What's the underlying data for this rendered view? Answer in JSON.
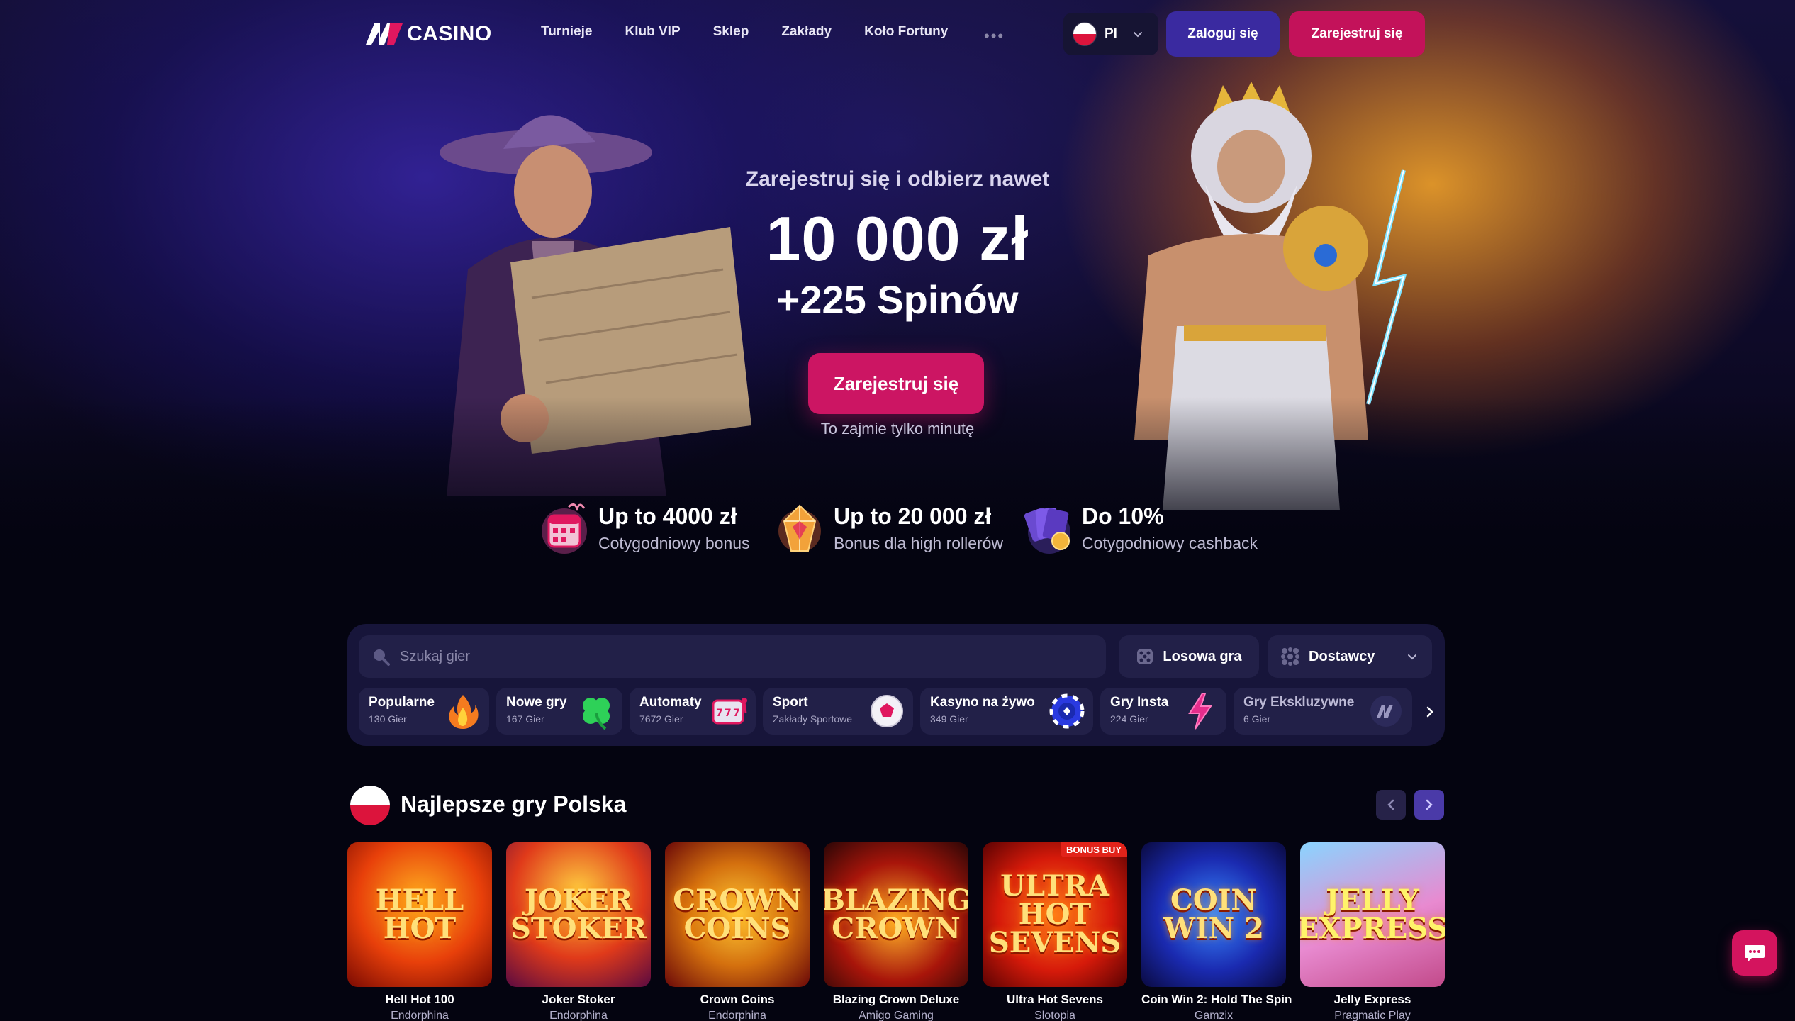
{
  "header": {
    "logo_text": "CASINO",
    "nav": [
      "Turnieje",
      "Klub VIP",
      "Sklep",
      "Zakłady",
      "Koło Fortuny"
    ],
    "more": "•••",
    "language": "Pl",
    "login_label": "Zaloguj się",
    "register_label": "Zarejestruj się"
  },
  "hero": {
    "subtitle": "Zarejestruj się i odbierz nawet",
    "amount": "10 000 zł",
    "spins": "+225 Spinów",
    "cta_label": "Zarejestruj się",
    "note": "To zajmie tylko minutę"
  },
  "benefits": [
    {
      "title": "Up to 4000 zł",
      "subtitle": "Cotygodniowy bonus",
      "icon": "calendar-gift-icon"
    },
    {
      "title": "Up to 20 000 zł",
      "subtitle": "Bonus dla high rollerów",
      "icon": "crystal-icon"
    },
    {
      "title": "Do 10%",
      "subtitle": "Cotygodniowy cashback",
      "icon": "cards-cashback-icon"
    }
  ],
  "games_panel": {
    "search_placeholder": "Szukaj gier",
    "random_label": "Losowa gra",
    "providers_label": "Dostawcy",
    "categories": [
      {
        "name": "Popularne",
        "count": "130 Gier",
        "icon": "fire-icon"
      },
      {
        "name": "Nowe gry",
        "count": "167 Gier",
        "icon": "clover-icon"
      },
      {
        "name": "Automaty",
        "count": "7672 Gier",
        "icon": "slot-machine-icon"
      },
      {
        "name": "Sport",
        "count": "Zakłady Sportowe",
        "icon": "football-icon"
      },
      {
        "name": "Kasyno na żywo",
        "count": "349 Gier",
        "icon": "poker-chip-icon"
      },
      {
        "name": "Gry Insta",
        "count": "224 Gier",
        "icon": "lightning-icon"
      },
      {
        "name": "Gry Ekskluzywne",
        "count": "6 Gier",
        "icon": "logo-badge-icon"
      }
    ]
  },
  "top_games": {
    "title": "Najlepsze gry Polska",
    "games": [
      {
        "name": "Hell Hot 100",
        "provider": "Endorphina",
        "thumb_text": "HELL HOT",
        "badge": ""
      },
      {
        "name": "Joker Stoker",
        "provider": "Endorphina",
        "thumb_text": "JOKER STOKER",
        "badge": ""
      },
      {
        "name": "Crown Coins",
        "provider": "Endorphina",
        "thumb_text": "CROWN COINS",
        "badge": ""
      },
      {
        "name": "Blazing Crown Deluxe",
        "provider": "Amigo Gaming",
        "thumb_text": "BLAZING CROWN",
        "badge": ""
      },
      {
        "name": "Ultra Hot Sevens",
        "provider": "Slotopia",
        "thumb_text": "ULTRA HOT SEVENS",
        "badge": "BONUS BUY"
      },
      {
        "name": "Coin Win 2: Hold The Spin",
        "provider": "Gamzix",
        "thumb_text": "COIN WIN 2",
        "badge": ""
      },
      {
        "name": "Jelly Express",
        "provider": "Pragmatic Play",
        "thumb_text": "JELLY EXPRESS",
        "badge": ""
      }
    ]
  },
  "colors": {
    "brand_pink": "#cc1563",
    "brand_purple": "#3a2aa0",
    "panel_bg": "#17153a"
  }
}
